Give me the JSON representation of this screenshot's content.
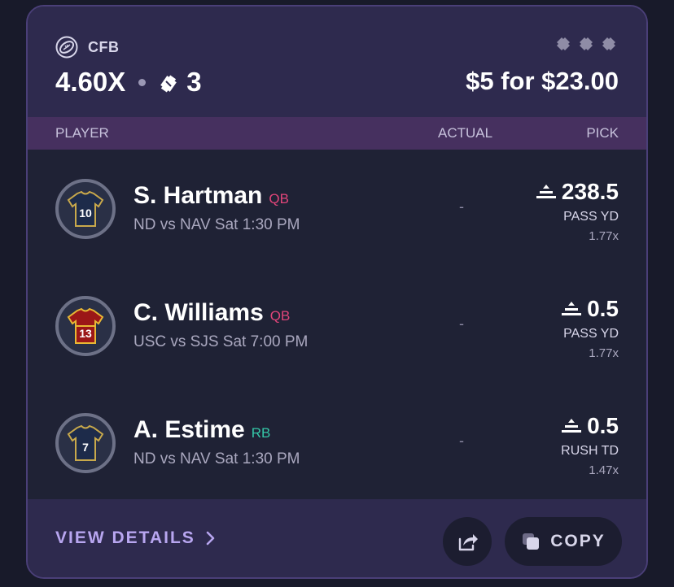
{
  "card": {
    "league": "CFB",
    "multiplier": "4.60X",
    "ticket_count": "3",
    "payout": "$5 for $23.00"
  },
  "columns": {
    "player": "PLAYER",
    "actual": "ACTUAL",
    "pick": "PICK"
  },
  "players": [
    {
      "name": "S. Hartman",
      "position": "QB",
      "game": "ND vs NAV Sat 1:30 PM",
      "actual": "-",
      "line": "238.5",
      "stat": "PASS YD",
      "mult": "1.77x",
      "jersey_number": "10",
      "jersey_color": "#1d2b4a",
      "jersey_trim": "#c9a94b"
    },
    {
      "name": "C. Williams",
      "position": "QB",
      "game": "USC vs SJS Sat 7:00 PM",
      "actual": "-",
      "line": "0.5",
      "stat": "PASS YD",
      "mult": "1.77x",
      "jersey_number": "13",
      "jersey_color": "#9b1717",
      "jersey_trim": "#e8b834"
    },
    {
      "name": "A. Estime",
      "position": "RB",
      "game": "ND vs NAV Sat 1:30 PM",
      "actual": "-",
      "line": "0.5",
      "stat": "RUSH TD",
      "mult": "1.47x",
      "jersey_number": "7",
      "jersey_color": "#1d2b4a",
      "jersey_trim": "#c9a94b"
    }
  ],
  "footer": {
    "details_label": "VIEW DETAILS",
    "copy_label": "COPY"
  },
  "icons": {
    "league": "football-icon",
    "tickets": "tickets-icon",
    "line_indicator": "line-icon",
    "chevron": "chevron-right-icon",
    "share": "share-icon",
    "copy": "copy-icon"
  },
  "colors": {
    "qb": "#e2457a",
    "rb": "#35c7a8",
    "accent": "#b8a6f0"
  }
}
